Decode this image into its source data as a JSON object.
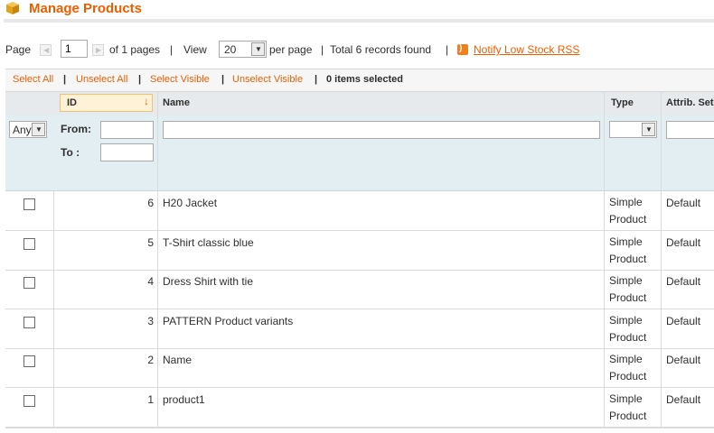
{
  "header": {
    "title": "Manage Products"
  },
  "pager": {
    "page_label": "Page",
    "page_value": "1",
    "of_pages": "of 1 pages",
    "view_label": "View",
    "per_page_value": "20",
    "per_page_label": "per page",
    "total": "Total 6 records found",
    "rss_label": "Notify Low Stock RSS",
    "separator": "|"
  },
  "massaction": {
    "select_all": "Select All",
    "unselect_all": "Unselect All",
    "select_visible": "Select Visible",
    "unselect_visible": "Unselect Visible",
    "items_selected": "0 items selected",
    "separator": "|"
  },
  "columns": {
    "id": "ID",
    "name": "Name",
    "type": "Type",
    "attrib": "Attrib. Set"
  },
  "filters": {
    "massaction_select": "Any",
    "from_label": "From:",
    "to_label": "To :"
  },
  "rows": [
    {
      "id": "6",
      "name": "H20 Jacket",
      "type": "Simple Product",
      "attrib": "Default"
    },
    {
      "id": "5",
      "name": "T-Shirt classic blue",
      "type": "Simple Product",
      "attrib": "Default"
    },
    {
      "id": "4",
      "name": "Dress Shirt with tie",
      "type": "Simple Product",
      "attrib": "Default"
    },
    {
      "id": "3",
      "name": "PATTERN Product variants",
      "type": "Simple Product",
      "attrib": "Default"
    },
    {
      "id": "2",
      "name": "Name",
      "type": "Simple Product",
      "attrib": "Default"
    },
    {
      "id": "1",
      "name": "product1",
      "type": "Simple Product",
      "attrib": "Default"
    }
  ],
  "colors": {
    "accent": "#eb5e00",
    "filter_bg": "#e3eef3",
    "header_bg": "#e7eaec"
  },
  "icons": {
    "title": "box-icon",
    "rss": "rss-icon",
    "sort": "sort-down-arrow-icon"
  }
}
